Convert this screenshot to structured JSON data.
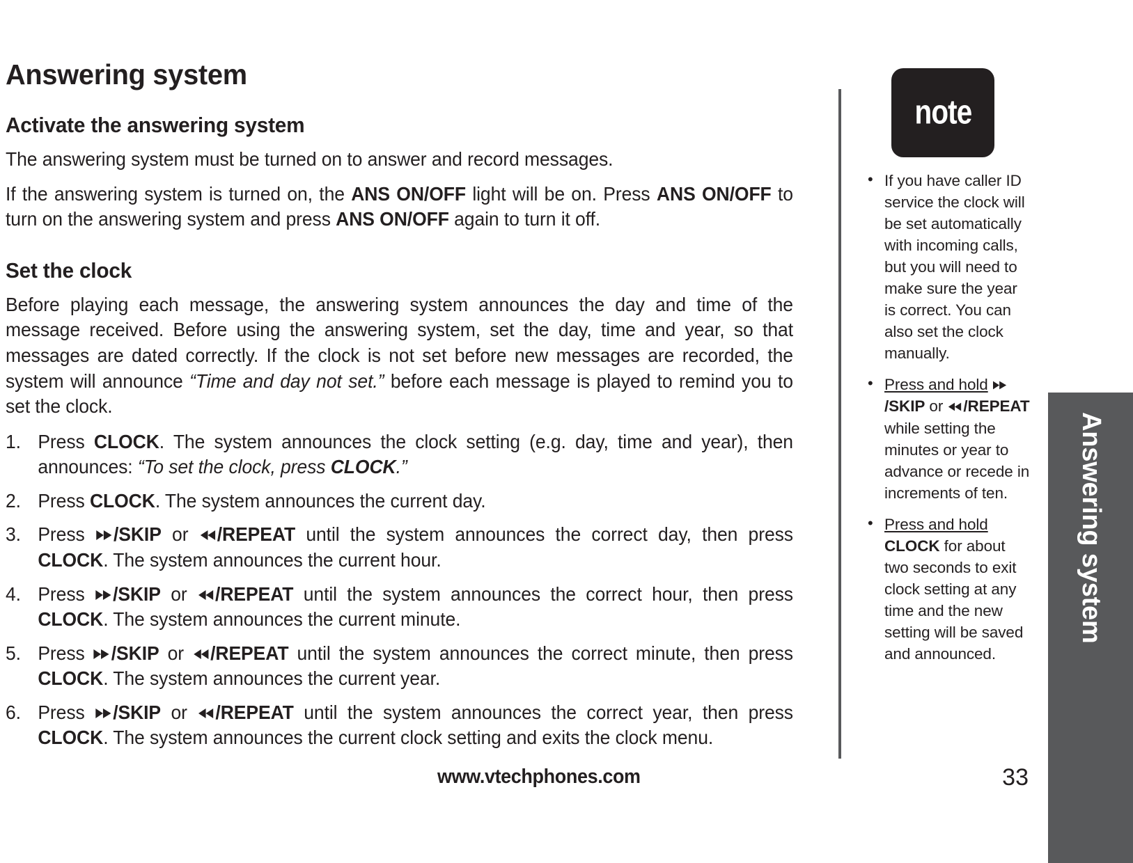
{
  "document": {
    "title": "Answering system",
    "page_number": "33",
    "footer_url": "www.vtechphones.com",
    "side_tab_label": "Answering system"
  },
  "icons": {
    "skip": "fast-forward-icon",
    "repeat": "rewind-icon"
  },
  "sections": {
    "activate": {
      "heading": "Activate the answering system",
      "paragraph_1": "The answering system must be turned on to answer and record messages.",
      "paragraph_2_parts": {
        "a": "If the answering system is turned on, the ",
        "b": "ANS ON/OFF",
        "c": " light will be on. Press ",
        "d": "ANS ON/OFF",
        "e": " to turn on the answering system and press ",
        "f": "ANS ON/OFF",
        "g": " again to turn it off."
      }
    },
    "set_clock": {
      "heading": "Set the clock",
      "intro_parts": {
        "a": "Before playing each message, the answering system announces the day and time of the message received. Before using the answering system, set the day, time and year, so that messages are dated correctly. If the clock is not set before new messages are recorded, the system will announce ",
        "b": "“Time and day not set.”",
        "c": " before each message is played to remind you to set the clock."
      },
      "steps": [
        {
          "line1_a": "Press ",
          "line1_b": "CLOCK",
          "line1_c": ". The system announces the clock setting (e.g. day, time and year), then announces: ",
          "line1_quote_a": "“To set the clock, press ",
          "line1_quote_b": "CLOCK",
          "line1_quote_c": ".”"
        },
        {
          "line1_a": "Press ",
          "line1_b": "CLOCK",
          "line1_c": ". The system announces the current day."
        },
        {
          "pre": "Press ",
          "skip": "/SKIP",
          "mid": " or ",
          "repeat": "/REPEAT",
          "post": " until the system announces the correct day, then press ",
          "clock": "CLOCK",
          "tail": ". The system announces the current hour."
        },
        {
          "pre": "Press ",
          "skip": "/SKIP",
          "mid": " or ",
          "repeat": "/REPEAT",
          "post": " until the system announces the correct hour, then press ",
          "clock": "CLOCK",
          "tail": ". The system announces the current minute."
        },
        {
          "pre": "Press ",
          "skip": "/SKIP",
          "mid": " or ",
          "repeat": "/REPEAT",
          "post": " until the system announces the correct minute, then press ",
          "clock": "CLOCK",
          "tail": ". The system announces the current year."
        },
        {
          "pre": "Press ",
          "skip": "/SKIP",
          "mid": " or ",
          "repeat": "/REPEAT",
          "post": " until the system announces the correct year, then press ",
          "clock": "CLOCK",
          "tail": ". The system announces the current clock setting and exits the clock menu."
        }
      ]
    }
  },
  "note_panel": {
    "badge_label": "note",
    "bullets": [
      {
        "text": "If you have caller ID service the clock will be set automatically with incoming calls, but you will need to make sure the year is correct. You can also set the clock manually."
      },
      {
        "underlined": "Press and hold",
        "skip": "/SKIP",
        "mid": " or ",
        "repeat": "/REPEAT",
        "tail": " while setting the minutes or year to advance or recede in increments of ten."
      },
      {
        "underlined": "Press and hold",
        "bold": "CLOCK",
        "tail": " for about two seconds to exit clock setting at any time and the new setting will be saved and announced."
      }
    ]
  },
  "colors": {
    "ink": "#231f20",
    "gray_bar": "#58595b",
    "badge_bg": "#231f20"
  }
}
